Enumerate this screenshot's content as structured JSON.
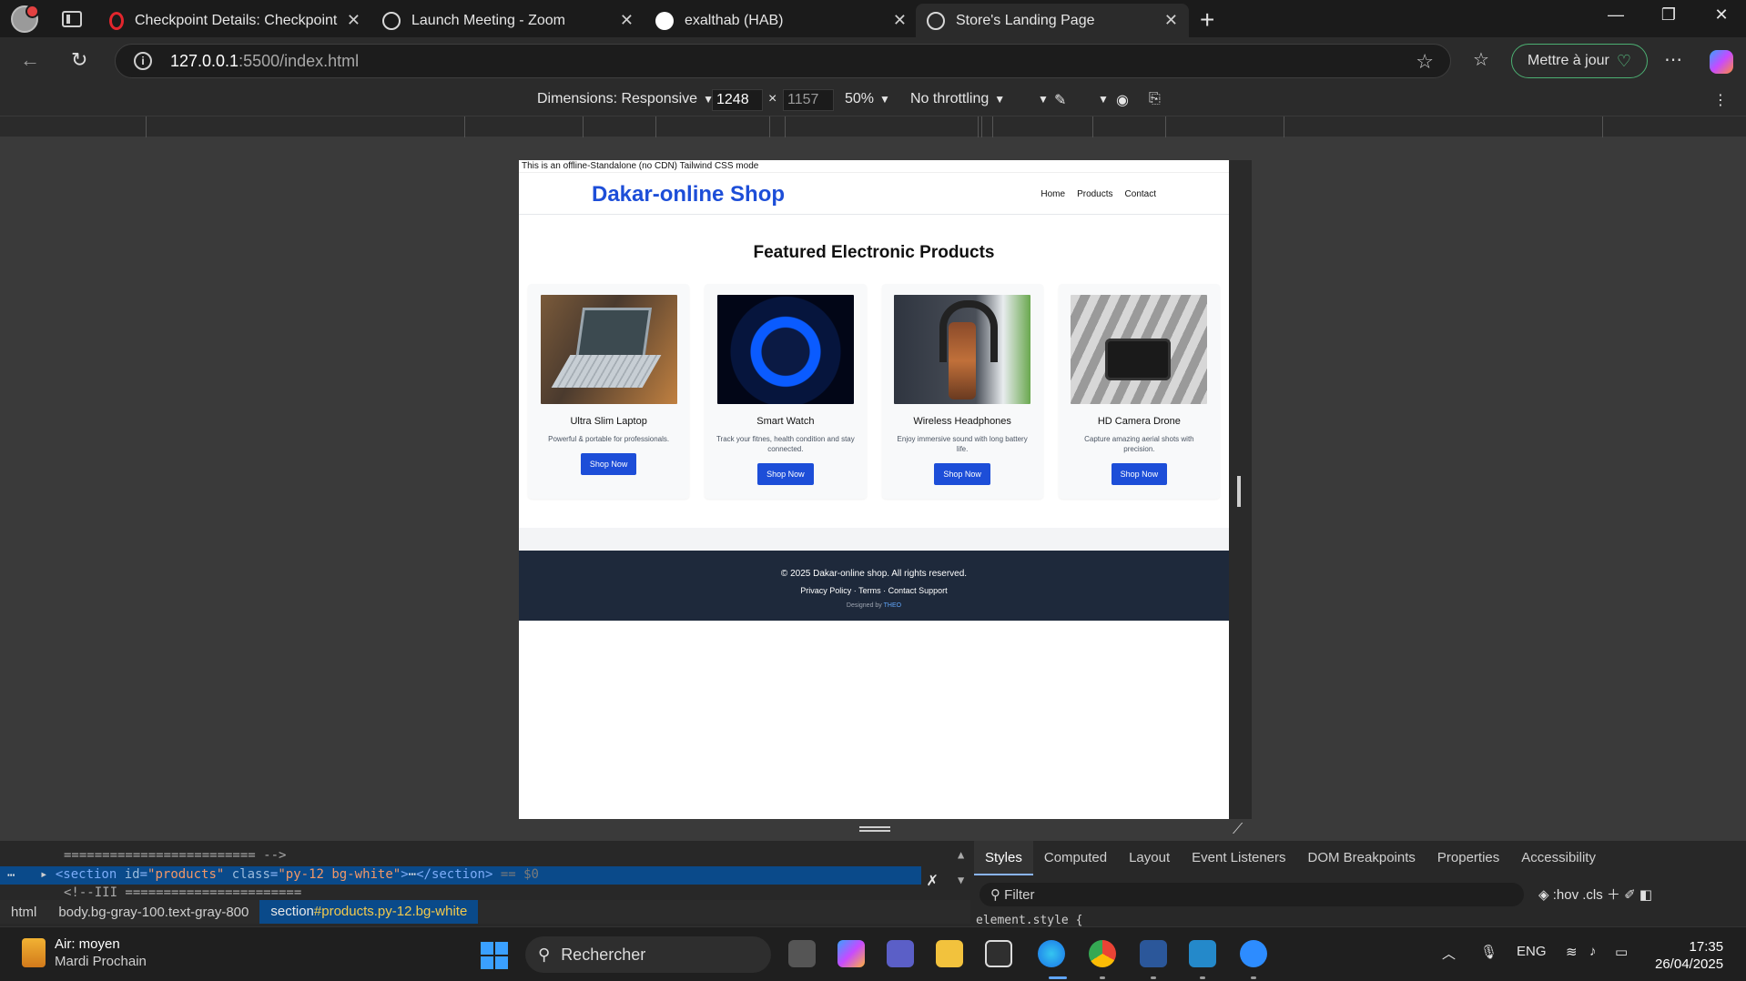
{
  "browser": {
    "tabs": [
      {
        "title": "Checkpoint Details: Checkpoint R",
        "icon": "opera-icon"
      },
      {
        "title": "Launch Meeting - Zoom",
        "icon": "globe-icon"
      },
      {
        "title": "exalthab (HAB)",
        "icon": "github-icon"
      },
      {
        "title": "Store's Landing Page",
        "icon": "globe-icon",
        "active": true
      }
    ],
    "url_host": "127.0.0.1",
    "url_path": ":5500/index.html",
    "update_label": "Mettre à jour"
  },
  "device_toolbar": {
    "dimensions_label": "Dimensions: Responsive",
    "width": "1248",
    "height": "1157",
    "times": "×",
    "zoom": "50%",
    "throttling": "No throttling"
  },
  "site": {
    "notice": "This is an offline-Standalone (no CDN) Tailwind CSS mode",
    "brand": "Dakar-online Shop",
    "nav": [
      "Home",
      "Products",
      "Contact"
    ],
    "section_title": "Featured Electronic Products",
    "products": [
      {
        "name": "Ultra Slim Laptop",
        "desc": "Powerful & portable for professionals.",
        "button": "Shop Now"
      },
      {
        "name": "Smart Watch",
        "desc": "Track your fitnes, health condition and stay connected.",
        "button": "Shop Now"
      },
      {
        "name": "Wireless Headphones",
        "desc": "Enjoy immersive sound with long battery life.",
        "button": "Shop Now"
      },
      {
        "name": "HD Camera Drone",
        "desc": "Capture amazing aerial shots with precision.",
        "button": "Shop Now"
      }
    ],
    "footer": {
      "copyright": "© 2025 Dakar-online shop. All rights reserved.",
      "links": "Privacy Policy · Terms · Contact Support",
      "designed_prefix": "Designed by",
      "designer": "THEO"
    }
  },
  "devtools": {
    "comment_line_1": "========================= -->",
    "selected_tag_open": "<section",
    "selected_attr_id": "id",
    "selected_val_id": "\"products\"",
    "selected_attr_class": "class",
    "selected_val_class": "\"py-12 bg-white\"",
    "selected_tag_mid": ">",
    "selected_ellipsis": "⋯",
    "selected_tag_close": "</section>",
    "selected_ref": "== $0",
    "comment_line_2": "<!--III =======================",
    "breadcrumbs": [
      "html",
      "body.bg-gray-100.text-gray-800"
    ],
    "breadcrumb_active_tag": "section",
    "breadcrumb_active_rest": "#products.py-12.bg-white",
    "style_tabs": [
      "Styles",
      "Computed",
      "Layout",
      "Event Listeners",
      "DOM Breakpoints",
      "Properties",
      "Accessibility"
    ],
    "filter_placeholder": "Filter",
    "hov": ":hov",
    "cls": ".cls",
    "element_style": "element.style {"
  },
  "taskbar": {
    "weather_line1": "Air: moyen",
    "weather_line2": "Mardi Prochain",
    "search_label": "Rechercher",
    "language": "ENG",
    "time": "17:35",
    "date": "26/04/2025"
  },
  "colors": {
    "brand_blue": "#1d4ed8",
    "footer_bg": "#1e293b",
    "devtools_selection": "#0a4a8a"
  }
}
